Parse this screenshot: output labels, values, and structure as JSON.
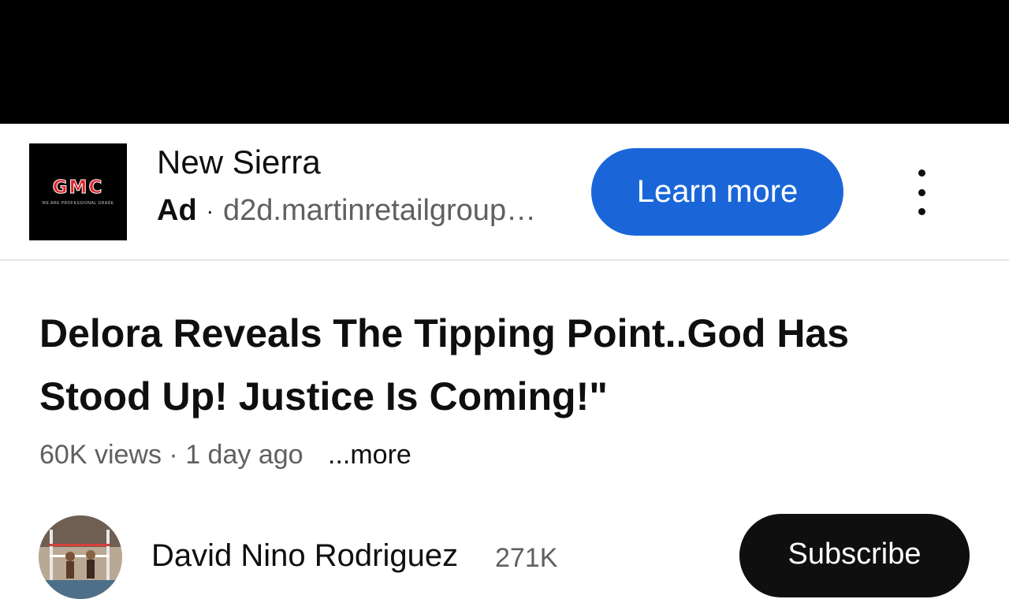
{
  "ad": {
    "logo_text": "GMC",
    "logo_tagline": "WE ARE PROFESSIONAL GRADE",
    "title": "New Sierra",
    "badge": "Ad",
    "separator": "·",
    "domain": "d2d.martinretailgroup.com",
    "cta_label": "Learn more",
    "cta_color": "#1a66d9",
    "menu_icon": "more-vertical-icon"
  },
  "video": {
    "title": "Delora Reveals The Tipping Point..God Has Stood Up! Justice Is Coming!\"",
    "views": "60K views",
    "separator": "·",
    "age": "1 day ago",
    "more_label": "...more"
  },
  "channel": {
    "name": "David Nino Rodriguez",
    "subscribers": "271K",
    "subscribe_label": "Subscribe"
  }
}
